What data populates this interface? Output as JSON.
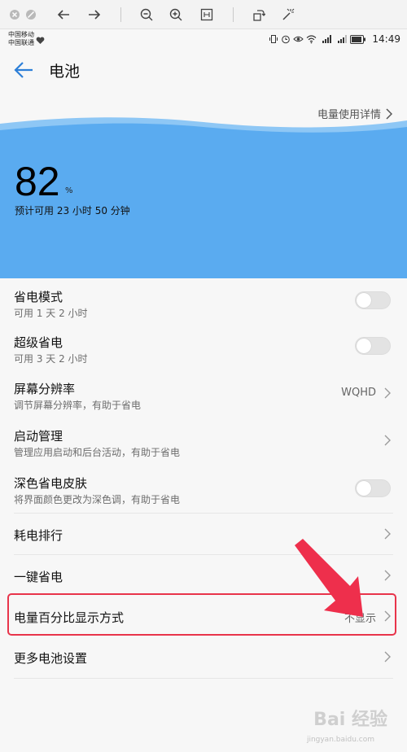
{
  "viewer_toolbar": {
    "icons": [
      "close-circle-icon",
      "stop-circle-icon",
      "back-arrow-icon",
      "forward-arrow-icon",
      "zoom-out-icon",
      "zoom-in-icon",
      "fit-screen-icon",
      "rotate-icon",
      "magic-wand-icon"
    ]
  },
  "statusbar": {
    "carrier_1": "中国移动",
    "carrier_2": "中国联通",
    "time": "14:49"
  },
  "header": {
    "title": "电池"
  },
  "battery": {
    "detail_link": "电量使用详情",
    "percent": "82",
    "percent_unit": "%",
    "estimate": "预计可用 23 小时 50 分钟",
    "accent_color": "#5aabf0"
  },
  "settings": {
    "power_saving": {
      "title": "省电模式",
      "subtitle": "可用 1 天 2 小时",
      "enabled": false
    },
    "super_saving": {
      "title": "超级省电",
      "subtitle": "可用 3 天 2 小时",
      "enabled": false
    },
    "resolution": {
      "title": "屏幕分辨率",
      "subtitle": "调节屏幕分辨率，有助于省电",
      "value": "WQHD"
    },
    "startup": {
      "title": "启动管理",
      "subtitle": "管理应用启动和后台活动，有助于省电"
    },
    "dark_skin": {
      "title": "深色省电皮肤",
      "subtitle": "将界面颜色更改为深色调，有助于省电",
      "enabled": false
    },
    "ranking": {
      "title": "耗电排行"
    },
    "one_key": {
      "title": "一键省电"
    },
    "percent_display": {
      "title": "电量百分比显示方式",
      "value": "不显示"
    },
    "more": {
      "title": "更多电池设置"
    }
  },
  "annotation": {
    "highlight_color": "#e8344b"
  },
  "watermark": {
    "brand": "Bai 经验",
    "url": "jingyan.baidu.com"
  }
}
